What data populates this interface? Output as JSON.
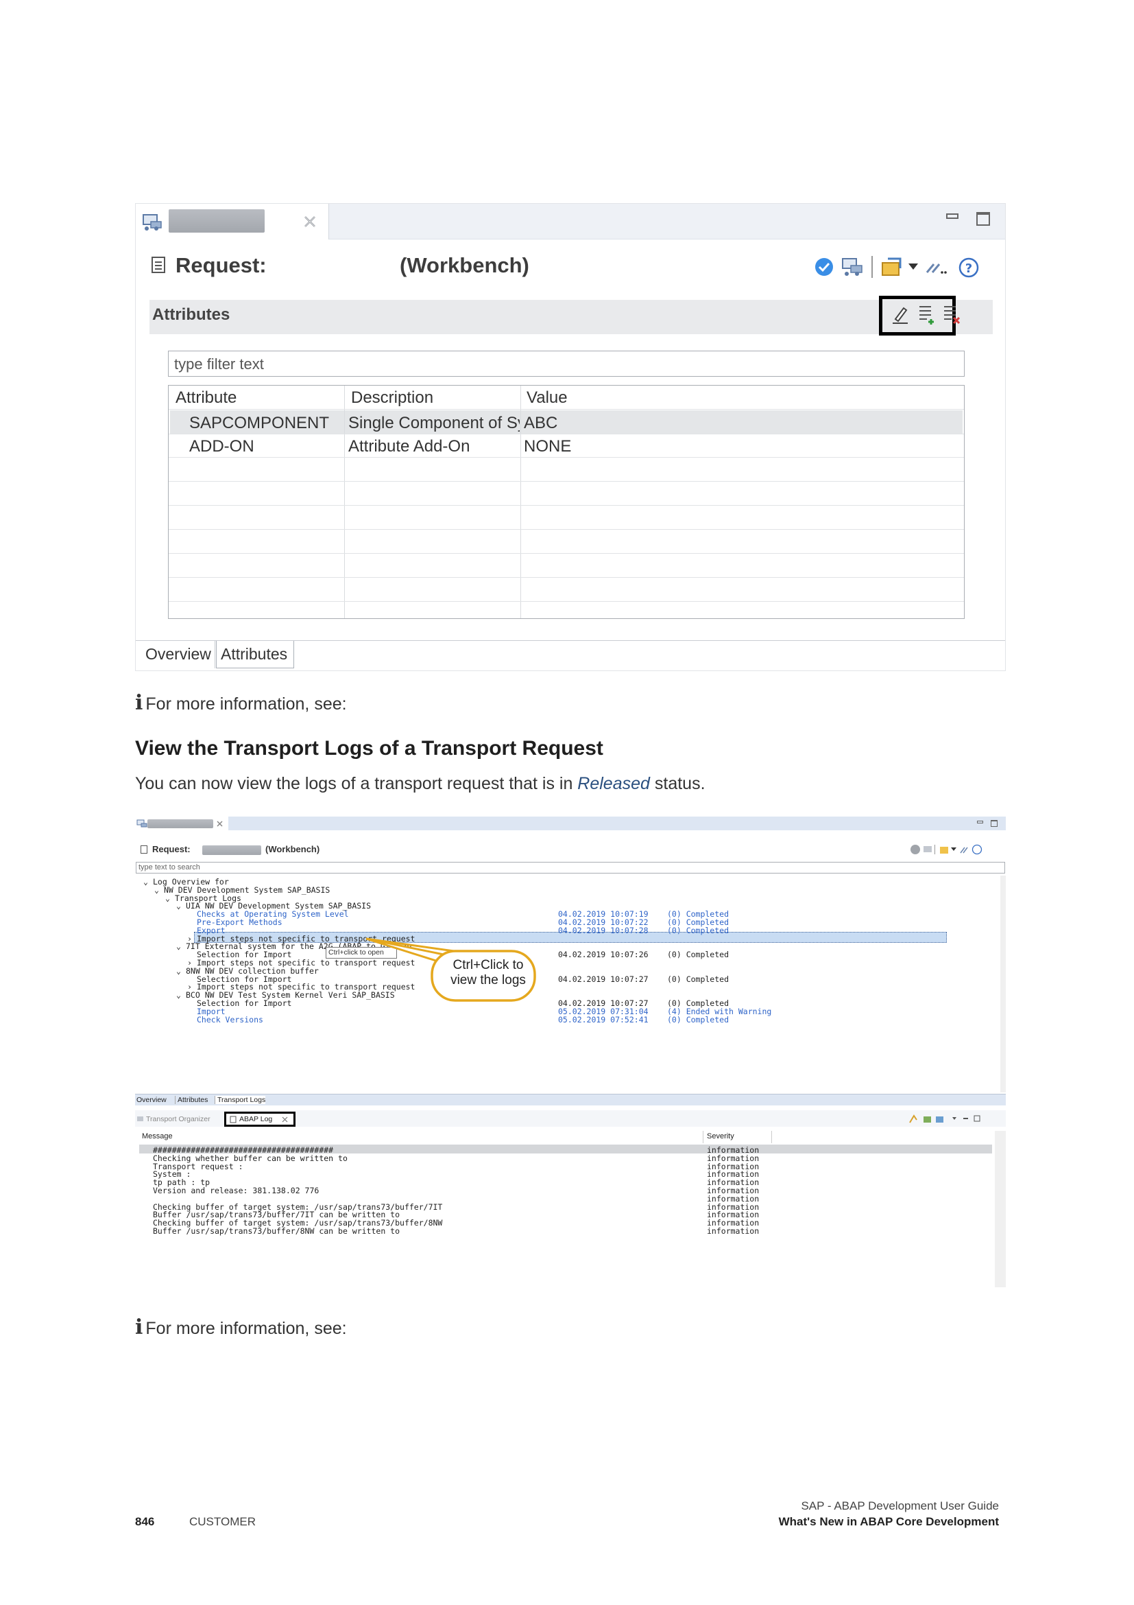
{
  "shot1": {
    "header": {
      "title": "Request:",
      "type": "(Workbench)"
    },
    "section_title": "Attributes",
    "filter_placeholder": "type filter text",
    "columns": [
      "Attribute",
      "Description",
      "Value"
    ],
    "rows": [
      [
        "SAPCOMPONENT",
        "Single Component of System Comp",
        "ABC"
      ],
      [
        "ADD-ON",
        "Attribute Add-On",
        "NONE"
      ]
    ],
    "bottom_tabs": [
      "Overview",
      "Attributes"
    ]
  },
  "note1": "For more information, see:",
  "heading": "View the Transport Logs of a Transport Request",
  "para": {
    "before": "You can now view the logs of a transport request that is in ",
    "emph": "Released",
    "after": " status."
  },
  "shot2": {
    "header": {
      "title": "Request:",
      "type": "(Workbench)"
    },
    "search_placeholder": "type text to search",
    "tree": [
      {
        "text": "Log Overview for",
        "indent": 0,
        "blue": false,
        "ts": "",
        "st": ""
      },
      {
        "text": "NW DEV Development System SAP_BASIS",
        "indent": 1,
        "blue": false,
        "ts": "",
        "st": ""
      },
      {
        "text": "Transport Logs",
        "indent": 2,
        "blue": false,
        "ts": "",
        "st": ""
      },
      {
        "text": "UIA  NW DEV Development System SAP_BASIS",
        "indent": 3,
        "blue": false,
        "ts": "",
        "st": ""
      },
      {
        "text": "Checks at Operating System Level",
        "indent": 4,
        "blue": true,
        "ts": "04.02.2019 10:07:19",
        "st": "(0) Completed"
      },
      {
        "text": "Pre-Export Methods",
        "indent": 4,
        "blue": true,
        "ts": "04.02.2019 10:07:22",
        "st": "(0) Completed"
      },
      {
        "text": "Export",
        "indent": 4,
        "blue": true,
        "ts": "04.02.2019 10:07:28",
        "st": "(0) Completed"
      },
      {
        "text": "Import steps not specific to transport request",
        "indent": 4,
        "blue": false,
        "ts": "",
        "st": ""
      },
      {
        "text": "7IT  External system for the A2G (ABAP to GIT) pr",
        "indent": 3,
        "blue": false,
        "ts": "",
        "st": ""
      },
      {
        "text": "Selection for Import",
        "indent": 4,
        "blue": false,
        "ts": "04.02.2019 10:07:26",
        "st": "(0) Completed"
      },
      {
        "text": "Import steps not specific to transport request",
        "indent": 4,
        "blue": false,
        "ts": "",
        "st": ""
      },
      {
        "text": "8NW  NW DEV collection buffer",
        "indent": 3,
        "blue": false,
        "ts": "",
        "st": ""
      },
      {
        "text": "Selection for Import",
        "indent": 4,
        "blue": false,
        "ts": "04.02.2019 10:07:27",
        "st": "(0) Completed"
      },
      {
        "text": "Import steps not specific to transport request",
        "indent": 4,
        "blue": false,
        "ts": "",
        "st": ""
      },
      {
        "text": "BCO  NW DEV Test System Kernel Veri SAP_BASIS",
        "indent": 3,
        "blue": false,
        "ts": "",
        "st": ""
      },
      {
        "text": "Selection for Import",
        "indent": 4,
        "blue": false,
        "ts": "04.02.2019 10:07:27",
        "st": "(0) Completed"
      },
      {
        "text": "Import",
        "indent": 4,
        "blue": true,
        "ts": "05.02.2019 07:31:04",
        "st": "(4) Ended with Warning"
      },
      {
        "text": "Check Versions",
        "indent": 4,
        "blue": true,
        "ts": "05.02.2019 07:52:41",
        "st": "(0) Completed"
      }
    ],
    "tooltip": "Ctrl+click to open",
    "callout": [
      "Ctrl+Click to",
      "view the logs"
    ],
    "tabs": [
      "Overview",
      "Attributes",
      "Transport Logs"
    ],
    "lower_tabs": [
      "Transport Organizer",
      "ABAP Log"
    ],
    "log_columns": [
      "Message",
      "Severity"
    ],
    "log_rows": [
      [
        "######################################",
        "information"
      ],
      [
        "Checking whether buffer can be written to",
        "information"
      ],
      [
        "Transport request   :",
        "information"
      ],
      [
        "System              :",
        "information"
      ],
      [
        "tp path             : tp",
        "information"
      ],
      [
        "Version and release: 381.138.02 776",
        "information"
      ],
      [
        "",
        "information"
      ],
      [
        "  Checking buffer of target system: /usr/sap/trans73/buffer/7IT",
        "information"
      ],
      [
        "Buffer /usr/sap/trans73/buffer/7IT can be written to",
        "information"
      ],
      [
        "    Checking buffer of target system: /usr/sap/trans73/buffer/8NW",
        "information"
      ],
      [
        "Buffer /usr/sap/trans73/buffer/8NW can be written to",
        "information"
      ]
    ]
  },
  "note2": "For more information, see:",
  "footer": {
    "page": "846",
    "label": "CUSTOMER",
    "guide": "SAP - ABAP Development User Guide",
    "chapter": "What's New in ABAP Core Development"
  }
}
